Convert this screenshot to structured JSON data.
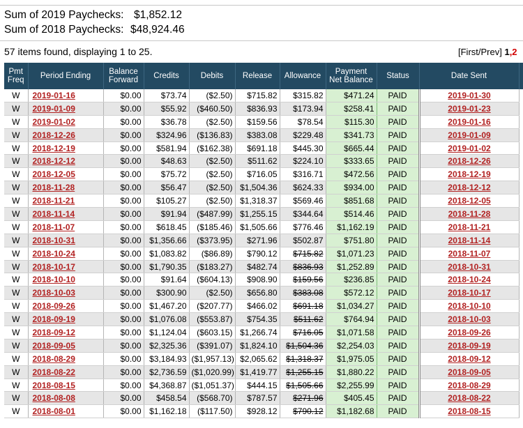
{
  "summary": {
    "line1_label": "Sum of 2019 Paychecks:",
    "line1_value": "$1,852.12",
    "line2_label": "Sum of 2018 Paychecks:",
    "line2_value": "$48,924.46"
  },
  "results": {
    "count_text": "57 items found, displaying 1 to 25.",
    "pager_first_prev": "[First/Prev] ",
    "pager_current": "1",
    "pager_next": ",2"
  },
  "table": {
    "headers": {
      "pmt_freq": "Pmt Freq",
      "period_ending": "Period Ending",
      "balance_forward": "Balance Forward",
      "credits": "Credits",
      "debits": "Debits",
      "release": "Release",
      "allowance": "Allowance",
      "payment_net_balance": "Payment Net Balance",
      "status": "Status",
      "date_sent": "Date Sent"
    },
    "rows": [
      {
        "freq": "W",
        "period": "2019-01-16",
        "balance": "$0.00",
        "credits": "$73.74",
        "debits": "($2.50)",
        "release": "$715.82",
        "allowance": "$315.82",
        "allow_struck": false,
        "payment": "$471.24",
        "status": "PAID",
        "sent": "2019-01-30"
      },
      {
        "freq": "W",
        "period": "2019-01-09",
        "balance": "$0.00",
        "credits": "$55.92",
        "debits": "($460.50)",
        "release": "$836.93",
        "allowance": "$173.94",
        "allow_struck": false,
        "payment": "$258.41",
        "status": "PAID",
        "sent": "2019-01-23"
      },
      {
        "freq": "W",
        "period": "2019-01-02",
        "balance": "$0.00",
        "credits": "$36.78",
        "debits": "($2.50)",
        "release": "$159.56",
        "allowance": "$78.54",
        "allow_struck": false,
        "payment": "$115.30",
        "status": "PAID",
        "sent": "2019-01-16"
      },
      {
        "freq": "W",
        "period": "2018-12-26",
        "balance": "$0.00",
        "credits": "$324.96",
        "debits": "($136.83)",
        "release": "$383.08",
        "allowance": "$229.48",
        "allow_struck": false,
        "payment": "$341.73",
        "status": "PAID",
        "sent": "2019-01-09"
      },
      {
        "freq": "W",
        "period": "2018-12-19",
        "balance": "$0.00",
        "credits": "$581.94",
        "debits": "($162.38)",
        "release": "$691.18",
        "allowance": "$445.30",
        "allow_struck": false,
        "payment": "$665.44",
        "status": "PAID",
        "sent": "2019-01-02"
      },
      {
        "freq": "W",
        "period": "2018-12-12",
        "balance": "$0.00",
        "credits": "$48.63",
        "debits": "($2.50)",
        "release": "$511.62",
        "allowance": "$224.10",
        "allow_struck": false,
        "payment": "$333.65",
        "status": "PAID",
        "sent": "2018-12-26"
      },
      {
        "freq": "W",
        "period": "2018-12-05",
        "balance": "$0.00",
        "credits": "$75.72",
        "debits": "($2.50)",
        "release": "$716.05",
        "allowance": "$316.71",
        "allow_struck": false,
        "payment": "$472.56",
        "status": "PAID",
        "sent": "2018-12-19"
      },
      {
        "freq": "W",
        "period": "2018-11-28",
        "balance": "$0.00",
        "credits": "$56.47",
        "debits": "($2.50)",
        "release": "$1,504.36",
        "allowance": "$624.33",
        "allow_struck": false,
        "payment": "$934.00",
        "status": "PAID",
        "sent": "2018-12-12"
      },
      {
        "freq": "W",
        "period": "2018-11-21",
        "balance": "$0.00",
        "credits": "$105.27",
        "debits": "($2.50)",
        "release": "$1,318.37",
        "allowance": "$569.46",
        "allow_struck": false,
        "payment": "$851.68",
        "status": "PAID",
        "sent": "2018-12-05"
      },
      {
        "freq": "W",
        "period": "2018-11-14",
        "balance": "$0.00",
        "credits": "$91.94",
        "debits": "($487.99)",
        "release": "$1,255.15",
        "allowance": "$344.64",
        "allow_struck": false,
        "payment": "$514.46",
        "status": "PAID",
        "sent": "2018-11-28"
      },
      {
        "freq": "W",
        "period": "2018-11-07",
        "balance": "$0.00",
        "credits": "$618.45",
        "debits": "($185.46)",
        "release": "$1,505.66",
        "allowance": "$776.46",
        "allow_struck": false,
        "payment": "$1,162.19",
        "status": "PAID",
        "sent": "2018-11-21"
      },
      {
        "freq": "W",
        "period": "2018-10-31",
        "balance": "$0.00",
        "credits": "$1,356.66",
        "debits": "($373.95)",
        "release": "$271.96",
        "allowance": "$502.87",
        "allow_struck": false,
        "payment": "$751.80",
        "status": "PAID",
        "sent": "2018-11-14"
      },
      {
        "freq": "W",
        "period": "2018-10-24",
        "balance": "$0.00",
        "credits": "$1,083.82",
        "debits": "($86.89)",
        "release": "$790.12",
        "allowance": "$715.82",
        "allow_struck": true,
        "payment": "$1,071.23",
        "status": "PAID",
        "sent": "2018-11-07"
      },
      {
        "freq": "W",
        "period": "2018-10-17",
        "balance": "$0.00",
        "credits": "$1,790.35",
        "debits": "($183.27)",
        "release": "$482.74",
        "allowance": "$836.93",
        "allow_struck": true,
        "payment": "$1,252.89",
        "status": "PAID",
        "sent": "2018-10-31"
      },
      {
        "freq": "W",
        "period": "2018-10-10",
        "balance": "$0.00",
        "credits": "$91.64",
        "debits": "($604.13)",
        "release": "$908.90",
        "allowance": "$159.56",
        "allow_struck": true,
        "payment": "$236.85",
        "status": "PAID",
        "sent": "2018-10-24"
      },
      {
        "freq": "W",
        "period": "2018-10-03",
        "balance": "$0.00",
        "credits": "$300.90",
        "debits": "($2.50)",
        "release": "$656.80",
        "allowance": "$383.08",
        "allow_struck": true,
        "payment": "$572.12",
        "status": "PAID",
        "sent": "2018-10-17"
      },
      {
        "freq": "W",
        "period": "2018-09-26",
        "balance": "$0.00",
        "credits": "$1,467.20",
        "debits": "($207.77)",
        "release": "$466.02",
        "allowance": "$691.18",
        "allow_struck": true,
        "payment": "$1,034.27",
        "status": "PAID",
        "sent": "2018-10-10"
      },
      {
        "freq": "W",
        "period": "2018-09-19",
        "balance": "$0.00",
        "credits": "$1,076.08",
        "debits": "($553.87)",
        "release": "$754.35",
        "allowance": "$511.62",
        "allow_struck": true,
        "payment": "$764.94",
        "status": "PAID",
        "sent": "2018-10-03"
      },
      {
        "freq": "W",
        "period": "2018-09-12",
        "balance": "$0.00",
        "credits": "$1,124.04",
        "debits": "($603.15)",
        "release": "$1,266.74",
        "allowance": "$716.05",
        "allow_struck": true,
        "payment": "$1,071.58",
        "status": "PAID",
        "sent": "2018-09-26"
      },
      {
        "freq": "W",
        "period": "2018-09-05",
        "balance": "$0.00",
        "credits": "$2,325.36",
        "debits": "($391.07)",
        "release": "$1,824.10",
        "allowance": "$1,504.36",
        "allow_struck": true,
        "payment": "$2,254.03",
        "status": "PAID",
        "sent": "2018-09-19"
      },
      {
        "freq": "W",
        "period": "2018-08-29",
        "balance": "$0.00",
        "credits": "$3,184.93",
        "debits": "($1,957.13)",
        "release": "$2,065.62",
        "allowance": "$1,318.37",
        "allow_struck": true,
        "payment": "$1,975.05",
        "status": "PAID",
        "sent": "2018-09-12"
      },
      {
        "freq": "W",
        "period": "2018-08-22",
        "balance": "$0.00",
        "credits": "$2,736.59",
        "debits": "($1,020.99)",
        "release": "$1,419.77",
        "allowance": "$1,255.15",
        "allow_struck": true,
        "payment": "$1,880.22",
        "status": "PAID",
        "sent": "2018-09-05"
      },
      {
        "freq": "W",
        "period": "2018-08-15",
        "balance": "$0.00",
        "credits": "$4,368.87",
        "debits": "($1,051.37)",
        "release": "$444.15",
        "allowance": "$1,505.66",
        "allow_struck": true,
        "payment": "$2,255.99",
        "status": "PAID",
        "sent": "2018-08-29"
      },
      {
        "freq": "W",
        "period": "2018-08-08",
        "balance": "$0.00",
        "credits": "$458.54",
        "debits": "($568.70)",
        "release": "$787.57",
        "allowance": "$271.96",
        "allow_struck": true,
        "payment": "$405.45",
        "status": "PAID",
        "sent": "2018-08-22"
      },
      {
        "freq": "W",
        "period": "2018-08-01",
        "balance": "$0.00",
        "credits": "$1,162.18",
        "debits": "($117.50)",
        "release": "$928.12",
        "allowance": "$790.12",
        "allow_struck": true,
        "payment": "$1,182.68",
        "status": "PAID",
        "sent": "2018-08-15"
      }
    ]
  }
}
